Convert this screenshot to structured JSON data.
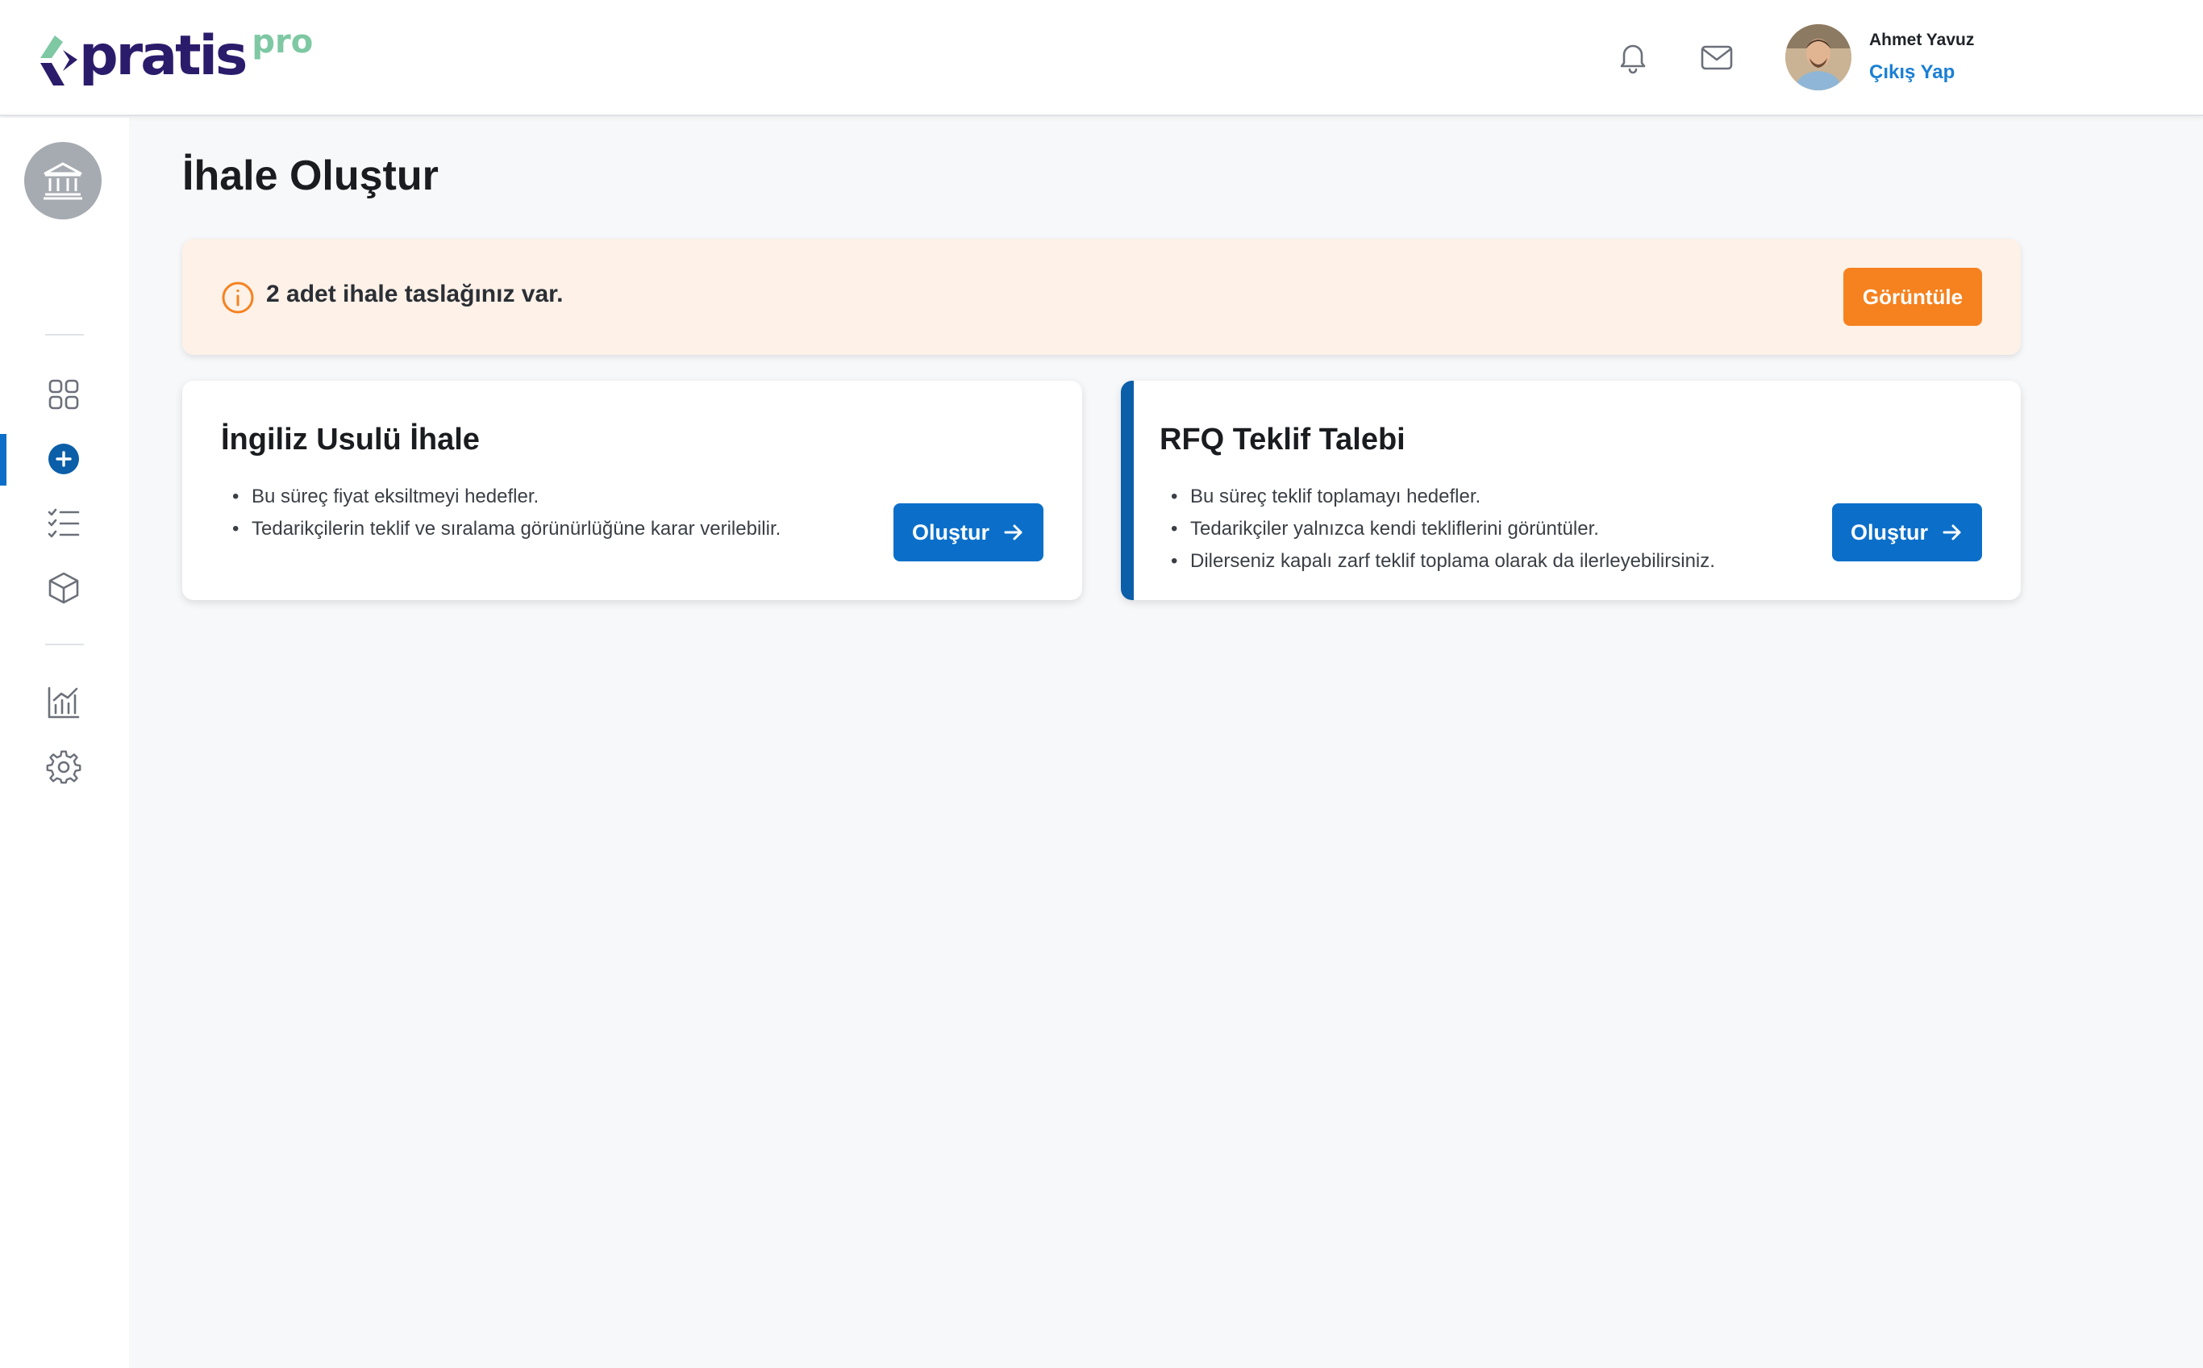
{
  "header": {
    "logo_text": "pratis",
    "logo_suffix": "pro",
    "user_name": "Ahmet Yavuz",
    "logout_label": "Çıkış Yap"
  },
  "sidebar": {
    "items": [
      {
        "icon": "dashboard-grid-icon"
      },
      {
        "icon": "plus-circle-icon",
        "active": true
      },
      {
        "icon": "checklist-icon"
      },
      {
        "icon": "box-icon"
      },
      {
        "icon": "chart-icon"
      },
      {
        "icon": "gear-icon"
      }
    ]
  },
  "main": {
    "title": "İhale Oluştur",
    "alert": {
      "text": "2 adet ihale taslağınız var.",
      "button_label": "Görüntüle"
    },
    "cards": [
      {
        "title": "İngiliz Usulü İhale",
        "bullets": [
          "Bu süreç fiyat eksiltmeyi hedefler.",
          "Tedarikçilerin teklif ve sıralama görünürlüğüne karar verilebilir."
        ],
        "button_label": "Oluştur"
      },
      {
        "title": "RFQ Teklif Talebi",
        "bullets": [
          "Bu süreç teklif toplamayı hedefler.",
          "Tedarikçiler yalnızca kendi tekliflerini görüntüler.",
          "Dilerseniz kapalı zarf teklif toplama olarak da ilerleyebilirsiniz."
        ],
        "button_label": "Oluştur"
      }
    ]
  },
  "colors": {
    "primary": "#0b6fc9",
    "orange": "#f5821f",
    "alert_bg": "#fdf1e8",
    "brand_dark": "#2b1c6b",
    "brand_green": "#7ec8a3"
  }
}
